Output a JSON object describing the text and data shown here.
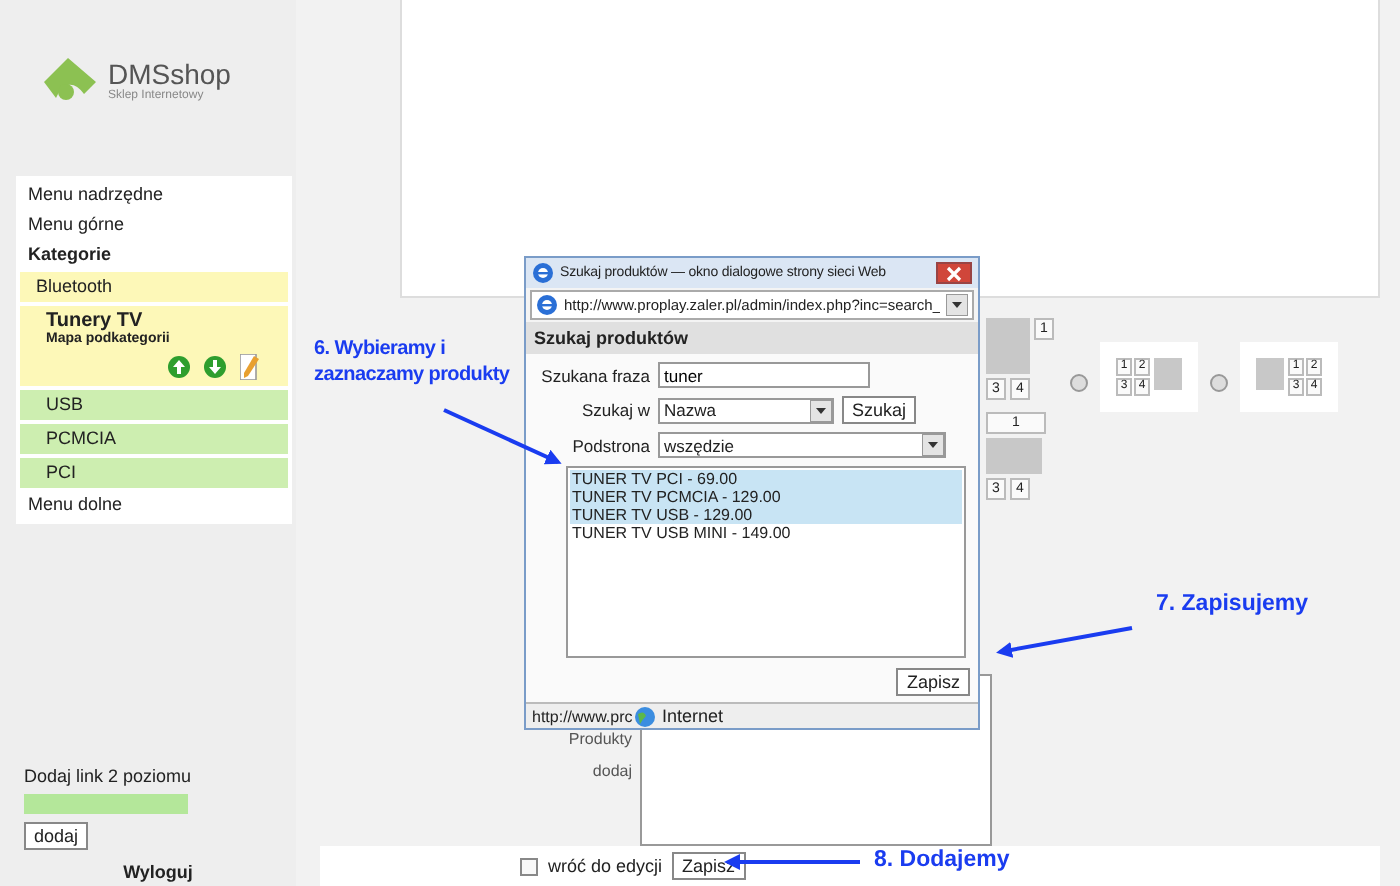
{
  "sidebar": {
    "logo": {
      "name": "DMSshop",
      "tagline": "Sklep Internetowy"
    },
    "menu": [
      {
        "kind": "link",
        "label": "Menu nadrzędne"
      },
      {
        "kind": "link",
        "label": "Menu górne"
      },
      {
        "kind": "heading",
        "label": "Kategorie"
      },
      {
        "kind": "category",
        "label": "Bluetooth",
        "expanded": false
      },
      {
        "kind": "category",
        "label": "Tunery TV",
        "sublabel": "Mapa podkategorii",
        "expanded": true,
        "children": [
          {
            "label": "USB"
          },
          {
            "label": "PCMCIA"
          },
          {
            "label": "PCI"
          }
        ]
      },
      {
        "kind": "link",
        "label": "Menu dolne"
      }
    ],
    "add_link": {
      "label": "Dodaj link 2 poziomu",
      "button": "dodaj"
    },
    "logout": "Wyloguj"
  },
  "main": {
    "layout_previews": [
      {
        "kind": "side",
        "cells": [
          "1",
          "3",
          "4"
        ]
      },
      {
        "kind": "top",
        "cells": [
          "1",
          "3",
          "4"
        ]
      }
    ],
    "layout_options": [
      {
        "kind": "grid-first",
        "cells": [
          "1",
          "2",
          "3",
          "4"
        ],
        "selected": false
      },
      {
        "kind": "grid-last",
        "cells": [
          "1",
          "2",
          "3",
          "4"
        ],
        "selected": false
      }
    ],
    "field_labels": [
      "Produkty",
      "dodaj"
    ],
    "return_to_edit": {
      "label": "wróć do edycji",
      "checked": false
    },
    "save_button": "Zapisz"
  },
  "dialog": {
    "title": "Szukaj produktów — okno dialogowe strony sieci Web",
    "address": "http://www.proplay.zaler.pl/admin/index.php?inc=search_",
    "heading": "Szukaj produktów",
    "phrase": {
      "label": "Szukana fraza",
      "value": "tuner"
    },
    "search_in": {
      "label": "Szukaj w",
      "value": "Nazwa",
      "button": "Szukaj"
    },
    "subpage": {
      "label": "Podstrona",
      "value": "wszędzie"
    },
    "results": [
      {
        "label": "TUNER TV PCI - 69.00",
        "selected": true
      },
      {
        "label": "TUNER TV PCMCIA - 129.00",
        "selected": true
      },
      {
        "label": "TUNER TV USB - 129.00",
        "selected": true
      },
      {
        "label": "TUNER TV USB MINI - 149.00",
        "selected": false
      }
    ],
    "save_button": "Zapisz",
    "status_url": "http://www.prc",
    "status_zone": "Internet"
  },
  "annotations": [
    {
      "text": "6. Wybieramy i zaznaczamy produkty"
    },
    {
      "text": "7. Zapisujemy"
    },
    {
      "text": "8. Dodajemy"
    }
  ]
}
